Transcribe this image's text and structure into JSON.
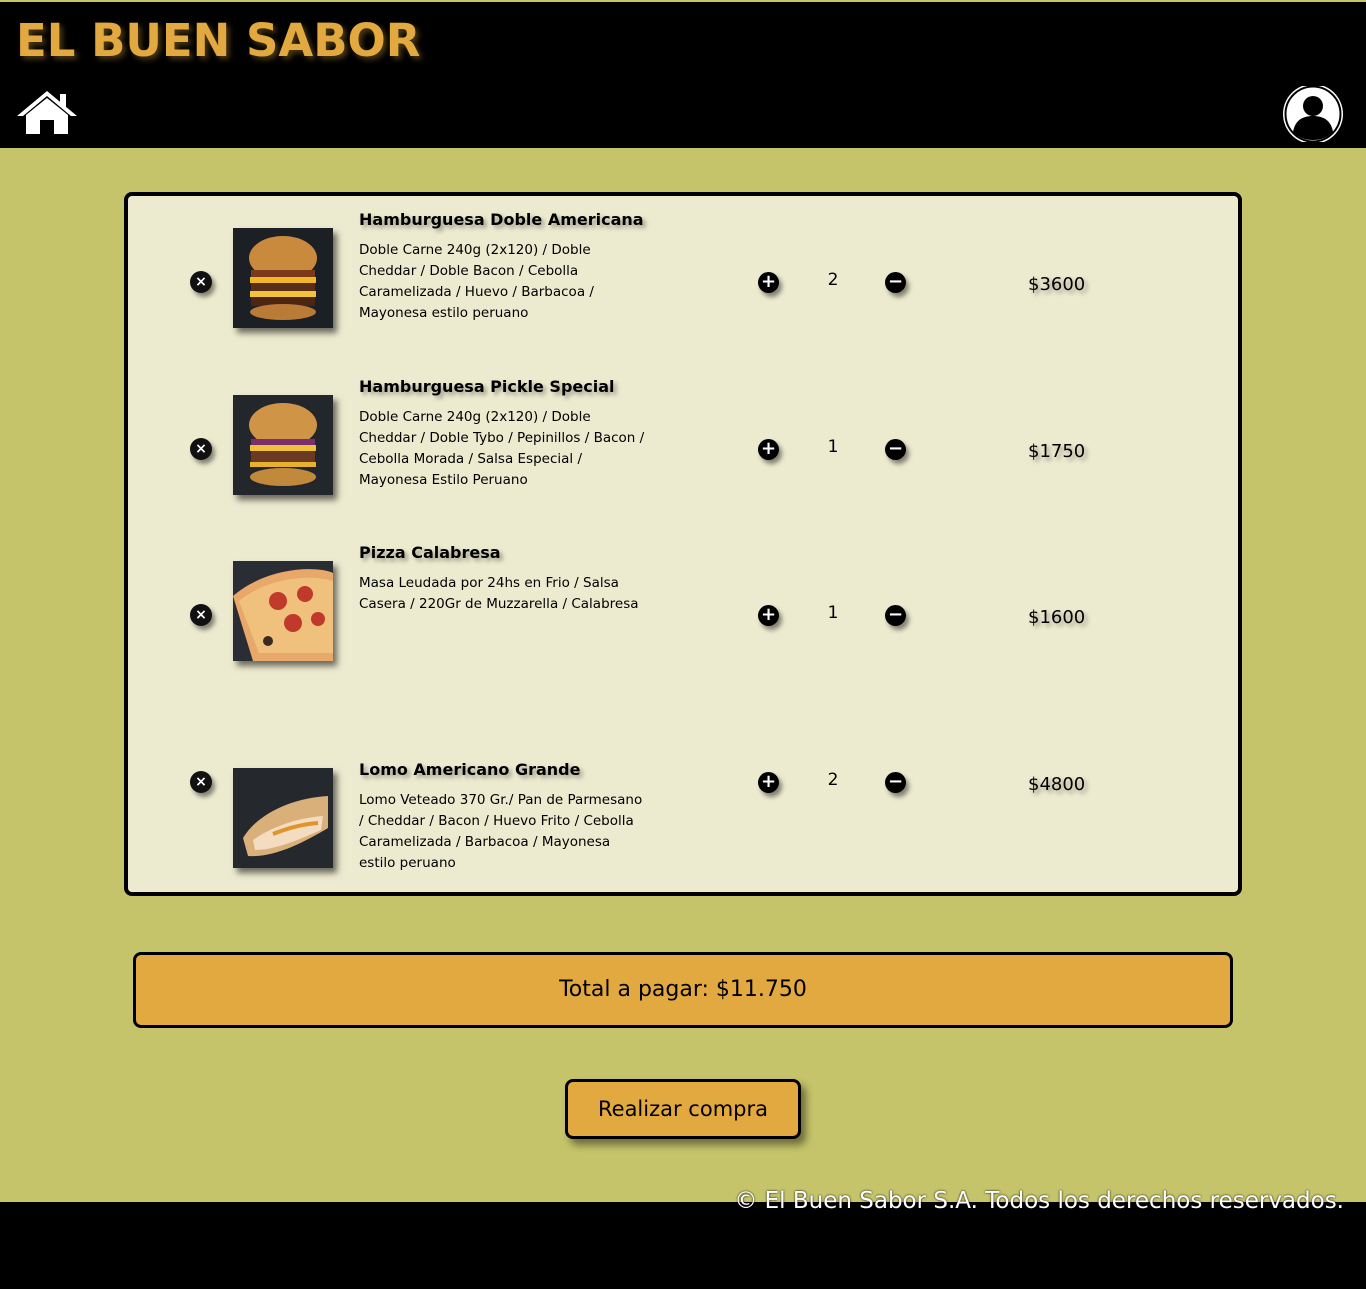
{
  "header": {
    "brand": "EL BUEN SABOR",
    "home_icon": "home-icon",
    "user_icon": "user-avatar-icon"
  },
  "cart": {
    "items": [
      {
        "name": "Hamburguesa Doble Americana",
        "description": "Doble Carne 240g (2x120) / Doble Cheddar / Doble Bacon / Cebolla Caramelizada / Huevo / Barbacoa / Mayonesa estilo peruano",
        "quantity": "2",
        "price": "$3600",
        "image": "burger-photo"
      },
      {
        "name": "Hamburguesa Pickle Special",
        "description": "Doble Carne 240g (2x120) / Doble Cheddar / Doble Tybo / Pepinillos / Bacon / Cebolla Morada / Salsa Especial / Mayonesa Estilo Peruano",
        "quantity": "1",
        "price": "$1750",
        "image": "burger-photo"
      },
      {
        "name": "Pizza Calabresa",
        "description": "Masa Leudada por 24hs en Frio / Salsa Casera / 220Gr de Muzzarella / Calabresa",
        "quantity": "1",
        "price": "$1600",
        "image": "pizza-photo"
      },
      {
        "name": "Lomo Americano Grande",
        "description": "Lomo Veteado 370 Gr./ Pan de Parmesano / Cheddar / Bacon / Huevo Frito / Cebolla Caramelizada / Barbacoa / Mayonesa estilo peruano",
        "quantity": "2",
        "price": "$4800",
        "image": "sandwich-photo"
      }
    ],
    "remove_symbol": "×",
    "plus_symbol": "+",
    "minus_symbol": "−"
  },
  "summary": {
    "total_label": "Total a pagar: $11.750",
    "buy_label": "Realizar compra"
  },
  "footer": {
    "copyright": "© El Buen Sabor S.A. Todos los derechos reservados."
  },
  "colors": {
    "background": "#c5c46b",
    "accent": "#e1a93f",
    "card": "#eceacf",
    "header": "#000000"
  }
}
